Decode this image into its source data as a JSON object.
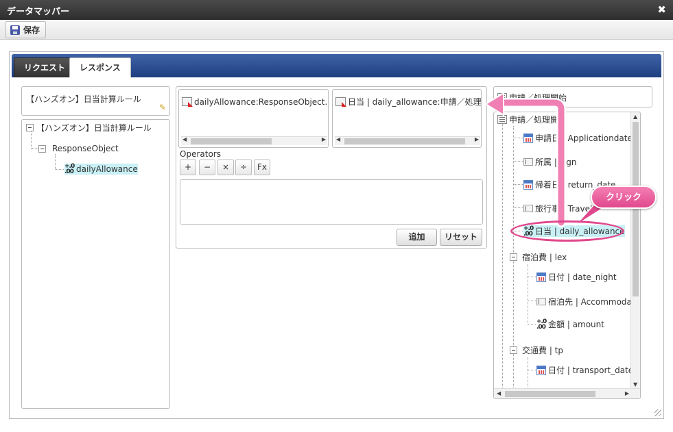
{
  "window": {
    "title": "データマッパー",
    "close_symbol": "✖"
  },
  "toolbar": {
    "save_label": "保存"
  },
  "tabs": [
    {
      "label": "リクエスト",
      "active": false
    },
    {
      "label": "レスポンス",
      "active": true
    }
  ],
  "left": {
    "title": "【ハンズオン】日当計算ルール",
    "tree": {
      "root": "【ハンズオン】日当計算ルール",
      "child": "ResponseObject",
      "leaf": "dailyAllowance"
    }
  },
  "middle": {
    "target_field": "dailyAllowance:ResponseObject.【ハ",
    "source_field": "日当 | daily_allowance:申請／処理開始",
    "operators_label": "Operators",
    "operators": [
      "+",
      "−",
      "×",
      "÷",
      "Fx"
    ],
    "add_label": "追加",
    "reset_label": "リセット"
  },
  "right": {
    "title": "申請／処理開始",
    "tree": [
      {
        "label": "申請／処理開",
        "type": "object",
        "level": 0
      },
      {
        "label": "申請日 | Applicationdate",
        "type": "date",
        "level": 1
      },
      {
        "label": "所属 | sign",
        "type": "string",
        "level": 1
      },
      {
        "label": "帰着日 | return_date",
        "type": "date",
        "level": 1
      },
      {
        "label": "旅行事 | Travel",
        "type": "string",
        "level": 1
      },
      {
        "label": "日当 | daily_allowance",
        "type": "number",
        "level": 1,
        "selected": true
      },
      {
        "label": "宿泊費 | lex",
        "type": "group",
        "level": 1
      },
      {
        "label": "日付 | date_night",
        "type": "date",
        "level": 2
      },
      {
        "label": "宿泊先 | Accommodati",
        "type": "string",
        "level": 2
      },
      {
        "label": "金額 | amount",
        "type": "number",
        "level": 2
      },
      {
        "label": "交通費 | tp",
        "type": "group",
        "level": 1
      },
      {
        "label": "日付 | transport_date",
        "type": "date",
        "level": 2
      }
    ]
  },
  "annotation": {
    "label": "クリック"
  },
  "colors": {
    "tab_bar": "#2b4c93",
    "highlight": "#e0488d",
    "selected_bg": "#c8f0f5"
  }
}
